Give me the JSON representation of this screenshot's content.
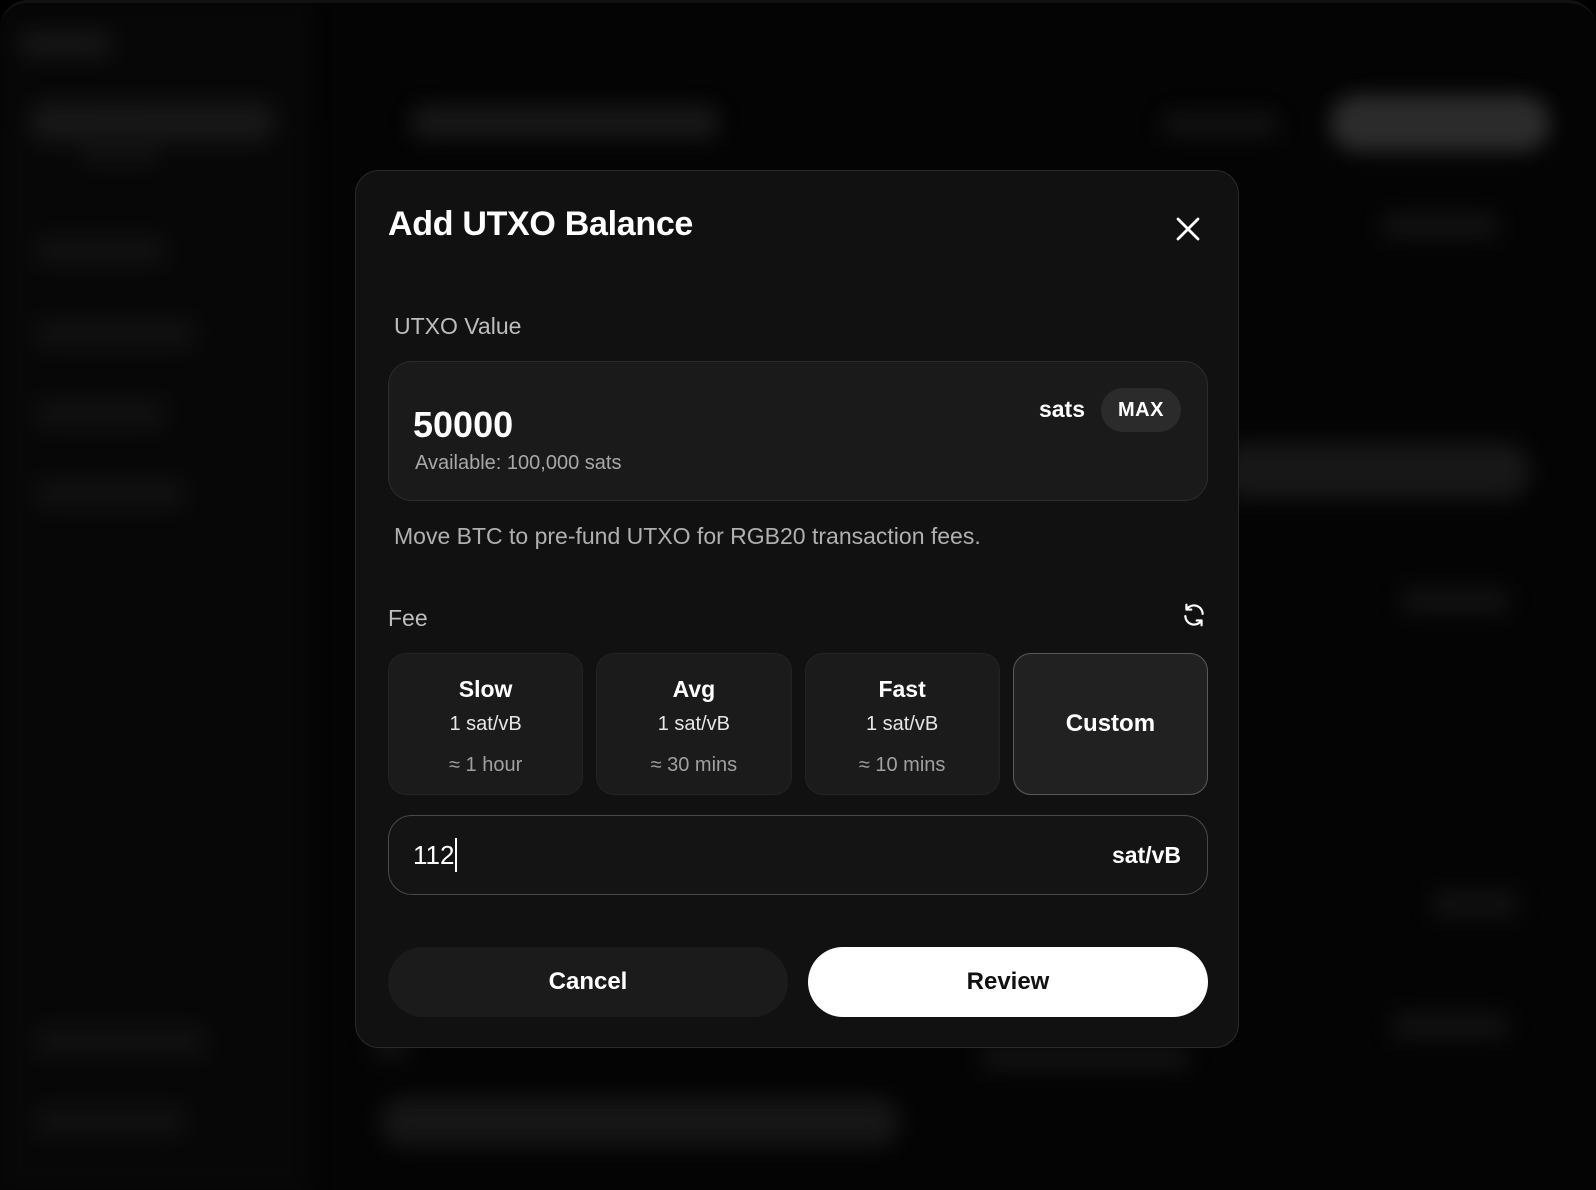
{
  "modal": {
    "title": "Add UTXO Balance",
    "utxo_value": {
      "label": "UTXO Value",
      "value": "50000",
      "unit": "sats",
      "max_label": "MAX",
      "available": "Available: 100,000 sats"
    },
    "hint": "Move BTC to pre-fund UTXO for RGB20 transaction fees.",
    "fee": {
      "label": "Fee",
      "options": [
        {
          "name": "Slow",
          "rate": "1 sat/vB",
          "eta": "≈ 1 hour"
        },
        {
          "name": "Avg",
          "rate": "1 sat/vB",
          "eta": "≈ 30 mins"
        },
        {
          "name": "Fast",
          "rate": "1 sat/vB",
          "eta": "≈ 10 mins"
        },
        {
          "name": "Custom"
        }
      ],
      "selected": "Custom",
      "custom_value": "112",
      "custom_unit": "sat/vB"
    },
    "buttons": {
      "cancel": "Cancel",
      "review": "Review"
    }
  },
  "icons": {
    "close": "close-icon",
    "refresh": "refresh-icon"
  },
  "colors": {
    "modal_bg": "#111111",
    "field_bg": "#1a1a1a",
    "primary_button": "#ffffff",
    "secondary_button": "#1b1b1b"
  }
}
